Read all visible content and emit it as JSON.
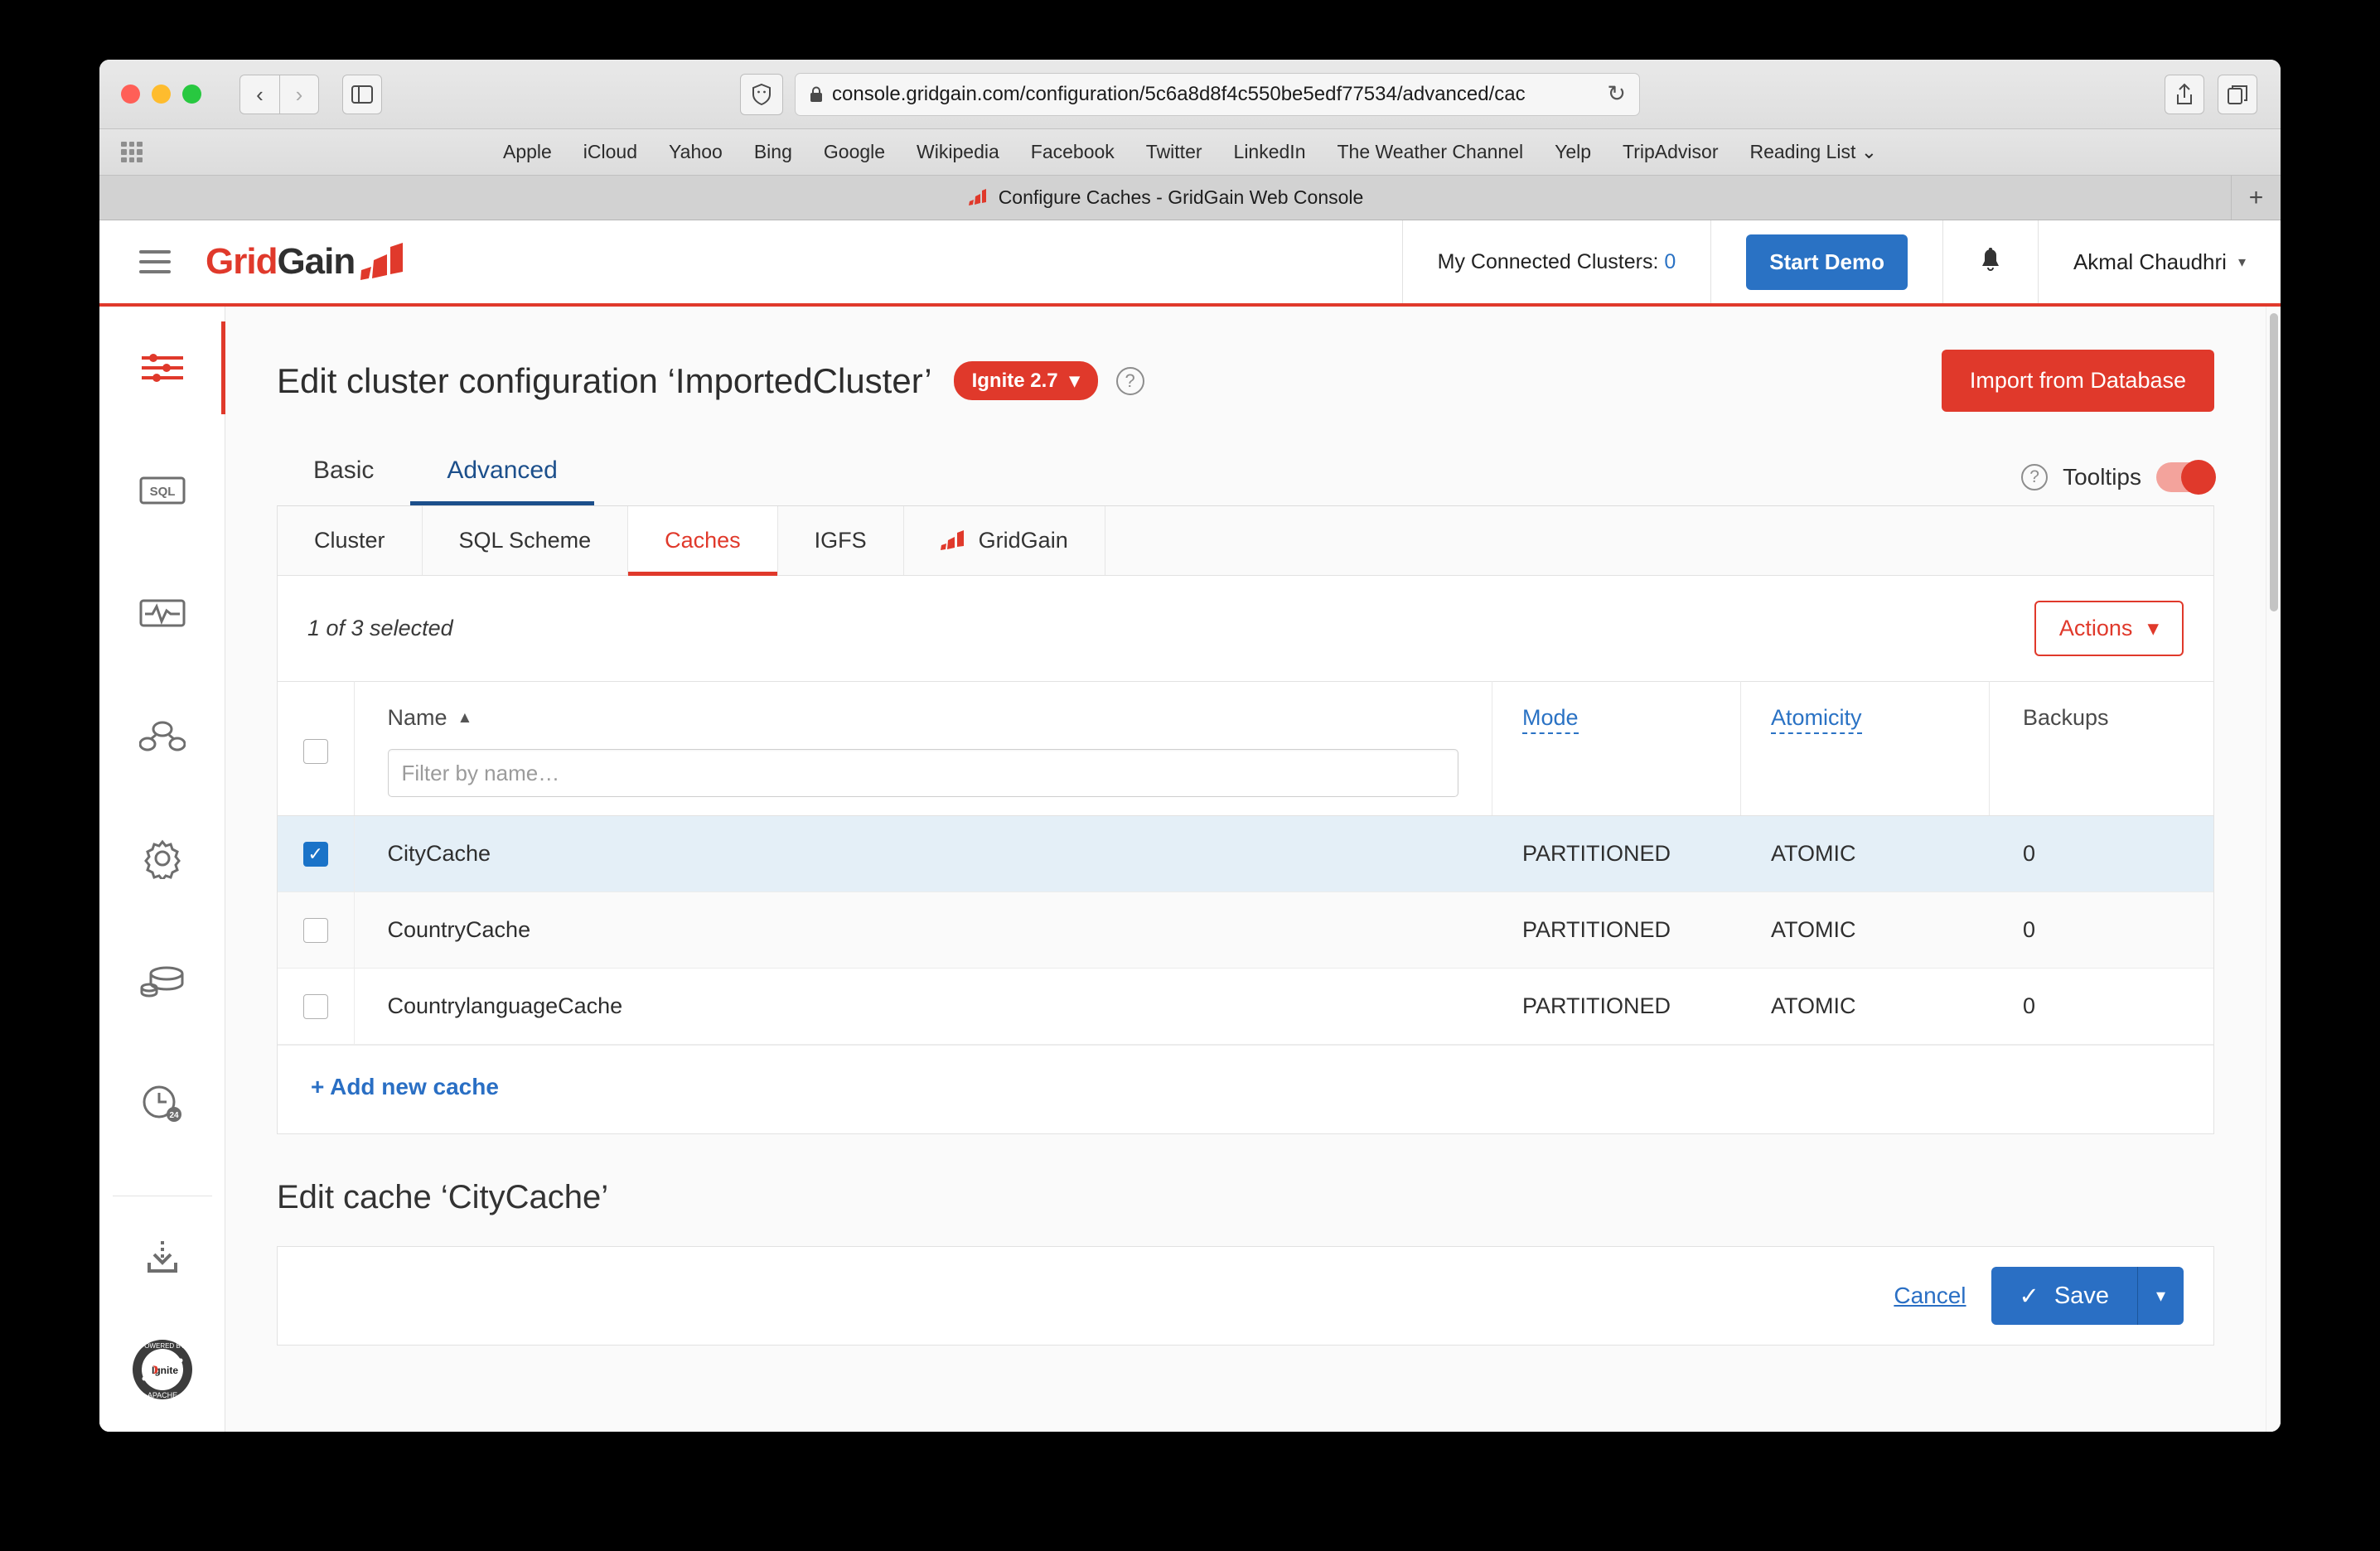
{
  "browser": {
    "url": "console.gridgain.com/configuration/5c6a8d8f4c550be5edf77534/advanced/cac",
    "tab_title": "Configure Caches - GridGain Web Console",
    "bookmarks": [
      "Apple",
      "iCloud",
      "Yahoo",
      "Bing",
      "Google",
      "Wikipedia",
      "Facebook",
      "Twitter",
      "LinkedIn",
      "The Weather Channel",
      "Yelp",
      "TripAdvisor",
      "Reading List ⌄"
    ],
    "back_icon": "‹",
    "forward_icon": "›",
    "sidebar_icon": "sidebar-icon",
    "reload_icon": "↻",
    "share_icon": "share-icon",
    "tabs_icon": "tabs-icon",
    "new_tab_icon": "+"
  },
  "app_header": {
    "logo_first": "Grid",
    "logo_second": "Gain",
    "clusters_label": "My Connected Clusters:",
    "clusters_count": "0",
    "start_demo_label": "Start Demo",
    "user_name": "Akmal Chaudhri",
    "user_caret": "▾",
    "accent_red": "#e0392b",
    "accent_blue": "#2a72c4"
  },
  "rail": {
    "items": [
      {
        "name": "configuration",
        "icon": "sliders-icon",
        "active": true
      },
      {
        "name": "queries",
        "icon": "sql-icon",
        "active": false
      },
      {
        "name": "monitoring",
        "icon": "monitoring-icon",
        "active": false
      },
      {
        "name": "clusters",
        "icon": "nodes-icon",
        "active": false
      },
      {
        "name": "settings",
        "icon": "gear-icon",
        "active": false
      },
      {
        "name": "caches",
        "icon": "database-icon",
        "active": false
      },
      {
        "name": "history",
        "icon": "clock-24-icon",
        "active": false
      }
    ],
    "footer": [
      {
        "name": "download",
        "icon": "download-icon"
      },
      {
        "name": "powered-by-apache-ignite",
        "icon": "apache-ignite-badge",
        "line1": "POWERED BY",
        "line2": "APACHE",
        "center": "Ignite"
      }
    ]
  },
  "page": {
    "title": "Edit cluster configuration ‘ImportedCluster’",
    "version_badge": "Ignite 2.7",
    "version_caret": "▾",
    "help_icon": "?",
    "import_button": "Import from Database",
    "main_tabs": [
      {
        "label": "Basic",
        "active": false
      },
      {
        "label": "Advanced",
        "active": true
      }
    ],
    "tooltips_label": "Tooltips",
    "tooltips_help_icon": "?",
    "tooltips_enabled": true,
    "sub_tabs": [
      {
        "label": "Cluster",
        "active": false,
        "icon": null
      },
      {
        "label": "SQL Scheme",
        "active": false,
        "icon": null
      },
      {
        "label": "Caches",
        "active": true,
        "icon": null
      },
      {
        "label": "IGFS",
        "active": false,
        "icon": null
      },
      {
        "label": "GridGain",
        "active": false,
        "icon": "gridgain-logo-icon"
      }
    ]
  },
  "caches_table": {
    "selection_text": "1 of 3 selected",
    "actions_label": "Actions",
    "actions_caret": "▾",
    "headers": {
      "name": "Name",
      "sort_caret": "▲",
      "mode": "Mode",
      "atomicity": "Atomicity",
      "backups": "Backups"
    },
    "filter_placeholder": "Filter by name…",
    "filter_value": "",
    "rows": [
      {
        "name": "CityCache",
        "mode": "PARTITIONED",
        "atomicity": "ATOMIC",
        "backups": "0",
        "selected": true
      },
      {
        "name": "CountryCache",
        "mode": "PARTITIONED",
        "atomicity": "ATOMIC",
        "backups": "0",
        "selected": false
      },
      {
        "name": "CountrylanguageCache",
        "mode": "PARTITIONED",
        "atomicity": "ATOMIC",
        "backups": "0",
        "selected": false
      }
    ],
    "add_link": "+ Add new cache"
  },
  "edit_section": {
    "title": "Edit cache ‘CityCache’",
    "cancel_label": "Cancel",
    "save_label": "Save",
    "save_check_icon": "✓",
    "save_caret": "▾"
  }
}
